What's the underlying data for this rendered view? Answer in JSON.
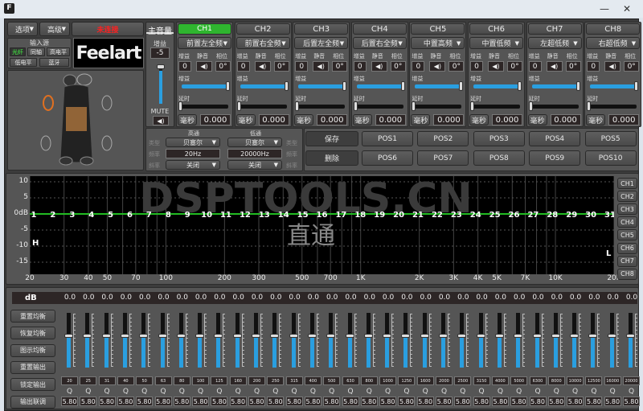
{
  "window": {
    "icon_label": "F",
    "minimize": "—",
    "close": "✕"
  },
  "top": {
    "options": "选项",
    "advanced": "高级",
    "status": "未连接",
    "status_color": "#ff2020"
  },
  "input_source": {
    "title": "输入源",
    "items": [
      "光纤",
      "同轴",
      "高电平",
      "低电平",
      "蓝牙"
    ],
    "active": "光纤"
  },
  "logo": "Feelart",
  "master": {
    "title": "主音量",
    "gain_label": "增益",
    "gain_value": "-5",
    "mute_label": "MUTE",
    "level": 0.9
  },
  "channel_labels": {
    "gain": "增益",
    "mute": "静音",
    "phase": "相位",
    "gain_slider": "增益",
    "delay": "延时",
    "unit": "毫秒"
  },
  "channels": [
    {
      "name": "CH1",
      "type": "前置左全频",
      "gain": "0",
      "phase": "0°",
      "delay": "0.000",
      "active": true
    },
    {
      "name": "CH2",
      "type": "前置右全频",
      "gain": "0",
      "phase": "0°",
      "delay": "0.000"
    },
    {
      "name": "CH3",
      "type": "后置左全频",
      "gain": "0",
      "phase": "0°",
      "delay": "0.000"
    },
    {
      "name": "CH4",
      "type": "后置右全频",
      "gain": "0",
      "phase": "0°",
      "delay": "0.000"
    },
    {
      "name": "CH5",
      "type": "中置高频",
      "gain": "0",
      "phase": "0°",
      "delay": "0.000"
    },
    {
      "name": "CH6",
      "type": "中置低频",
      "gain": "0",
      "phase": "0°",
      "delay": "0.000"
    },
    {
      "name": "CH7",
      "type": "左超低频",
      "gain": "0",
      "phase": "0°",
      "delay": "0.000"
    },
    {
      "name": "CH8",
      "type": "右超低频",
      "gain": "0",
      "phase": "0°",
      "delay": "0.000"
    }
  ],
  "crossover": {
    "row_labels": [
      "类型",
      "频率",
      "斜率"
    ],
    "highpass": {
      "title": "高通",
      "type": "贝塞尔",
      "freq": "20Hz",
      "slope": "关闭"
    },
    "lowpass": {
      "title": "低通",
      "type": "贝塞尔",
      "freq": "20000Hz",
      "slope": "关闭"
    }
  },
  "presets": {
    "save": "保存",
    "delete": "删除",
    "positions": [
      "POS1",
      "POS2",
      "POS3",
      "POS4",
      "POS5",
      "POS6",
      "POS7",
      "POS8",
      "POS9",
      "POS10"
    ]
  },
  "graph": {
    "y_ticks": [
      "10",
      "5",
      "0dB",
      "-5",
      "-10",
      "-15"
    ],
    "x_ticks": [
      "20",
      "30",
      "40",
      "50",
      "70",
      "100",
      "200",
      "300",
      "500",
      "700",
      "1K",
      "2K",
      "3K",
      "4K",
      "5K",
      "7K",
      "10K",
      "20K"
    ],
    "watermark": "DSPTOOLS.CN",
    "mode": "直通",
    "high_marker": "H",
    "low_marker": "L",
    "curve_color": "#22bb22",
    "channel_buttons": [
      "CH1",
      "CH2",
      "CH3",
      "CH4",
      "CH5",
      "CH6",
      "CH7",
      "CH8"
    ]
  },
  "eq": {
    "db_label": "dB",
    "q_label": "Q",
    "buttons": [
      "重置均衡",
      "恢复均衡",
      "图示均衡",
      "重置输出",
      "锁定输出",
      "输出联调"
    ],
    "bands": [
      {
        "f": "20",
        "g": "0.0",
        "q": "5.80"
      },
      {
        "f": "25",
        "g": "0.0",
        "q": "5.80"
      },
      {
        "f": "31",
        "g": "0.0",
        "q": "5.80"
      },
      {
        "f": "40",
        "g": "0.0",
        "q": "5.80"
      },
      {
        "f": "50",
        "g": "0.0",
        "q": "5.80"
      },
      {
        "f": "63",
        "g": "0.0",
        "q": "5.80"
      },
      {
        "f": "80",
        "g": "0.0",
        "q": "5.80"
      },
      {
        "f": "100",
        "g": "0.0",
        "q": "5.80"
      },
      {
        "f": "125",
        "g": "0.0",
        "q": "5.80"
      },
      {
        "f": "160",
        "g": "0.0",
        "q": "5.80"
      },
      {
        "f": "200",
        "g": "0.0",
        "q": "5.80"
      },
      {
        "f": "250",
        "g": "0.0",
        "q": "5.80"
      },
      {
        "f": "315",
        "g": "0.0",
        "q": "5.80"
      },
      {
        "f": "400",
        "g": "0.0",
        "q": "5.80"
      },
      {
        "f": "500",
        "g": "0.0",
        "q": "5.80"
      },
      {
        "f": "630",
        "g": "0.0",
        "q": "5.80"
      },
      {
        "f": "800",
        "g": "0.0",
        "q": "5.80"
      },
      {
        "f": "1000",
        "g": "0.0",
        "q": "5.80"
      },
      {
        "f": "1250",
        "g": "0.0",
        "q": "5.80"
      },
      {
        "f": "1600",
        "g": "0.0",
        "q": "5.80"
      },
      {
        "f": "2000",
        "g": "0.0",
        "q": "5.80"
      },
      {
        "f": "2500",
        "g": "0.0",
        "q": "5.80"
      },
      {
        "f": "3150",
        "g": "0.0",
        "q": "5.80"
      },
      {
        "f": "4000",
        "g": "0.0",
        "q": "5.80"
      },
      {
        "f": "5000",
        "g": "0.0",
        "q": "5.80"
      },
      {
        "f": "6300",
        "g": "0.0",
        "q": "5.80"
      },
      {
        "f": "8000",
        "g": "0.0",
        "q": "5.80"
      },
      {
        "f": "10000",
        "g": "0.0",
        "q": "5.80"
      },
      {
        "f": "12500",
        "g": "0.0",
        "q": "5.80"
      },
      {
        "f": "16000",
        "g": "0.0",
        "q": "5.80"
      },
      {
        "f": "20000",
        "g": "0.0",
        "q": "5.80"
      }
    ]
  },
  "colors": {
    "accent_blue": "#2a9fe0",
    "active_green": "#2fb52f"
  }
}
